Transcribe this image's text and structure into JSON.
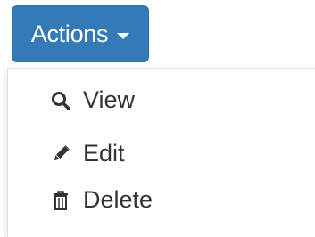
{
  "actions_button": {
    "label": "Actions",
    "caret_icon": "caret-down-icon",
    "background_color": "#337ab7",
    "text_color": "#ffffff"
  },
  "menu": {
    "items": [
      {
        "label": "View",
        "icon": "search-icon"
      },
      {
        "label": "Edit",
        "icon": "pencil-icon"
      },
      {
        "label": "Delete",
        "icon": "trash-icon"
      }
    ],
    "text_color": "#333333"
  }
}
